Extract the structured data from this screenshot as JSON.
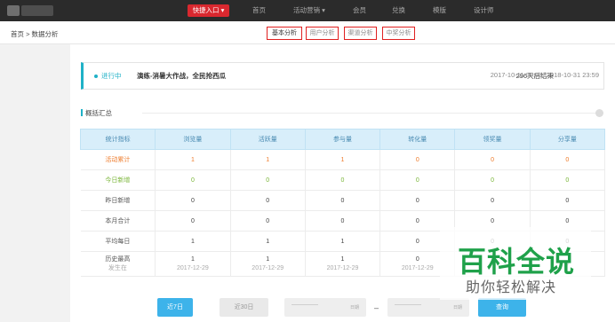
{
  "nav": {
    "quick_entry": "快捷入口 ▾",
    "items": [
      "首页",
      "活动营销 ▾",
      "会员",
      "兑换",
      "模版",
      "设计师"
    ]
  },
  "breadcrumb": "首页 > 数据分析",
  "tabs": [
    "基本分析",
    "用户分析",
    "渠道分析",
    "中奖分析"
  ],
  "status": {
    "state": "进行中",
    "title": "演练-消暑大作战，全民抢西瓜",
    "countdown": "296天后结束",
    "range": "2017-10-11 00:00~2018-10-31 23:59"
  },
  "section_title": "概括汇总",
  "table": {
    "headers": [
      "统计指标",
      "浏览量",
      "活跃量",
      "参与量",
      "转化量",
      "领奖量",
      "分享量"
    ],
    "rows": [
      [
        "活动累计",
        "1",
        "1",
        "1",
        "0",
        "0",
        "0"
      ],
      [
        "今日新增",
        "0",
        "0",
        "0",
        "0",
        "0",
        "0"
      ],
      [
        "昨日新增",
        "0",
        "0",
        "0",
        "0",
        "0",
        "0"
      ],
      [
        "本月合计",
        "0",
        "0",
        "0",
        "0",
        "0",
        "0"
      ],
      [
        "平均每日",
        "1",
        "1",
        "1",
        "0",
        "0",
        "0"
      ],
      [
        "历史最高",
        "1",
        "1",
        "1",
        "0",
        "0",
        "0"
      ]
    ],
    "peak_sub": [
      "发生在",
      "2017-12-29",
      "2017-12-29",
      "2017-12-29",
      "2017-12-29",
      "",
      ""
    ]
  },
  "controls": {
    "btn_7": "近7日",
    "btn_30": "近30日",
    "date_icon": "日期",
    "dash": "–",
    "query": "查询"
  },
  "watermark": {
    "big": "百科全说",
    "small": "助你轻松解决"
  },
  "colors": {
    "accent": "#1fb1c7",
    "button_blue": "#3db3ea",
    "orange": "#ee7b2b",
    "green": "#79b537",
    "nav_red": "#d9282f"
  }
}
